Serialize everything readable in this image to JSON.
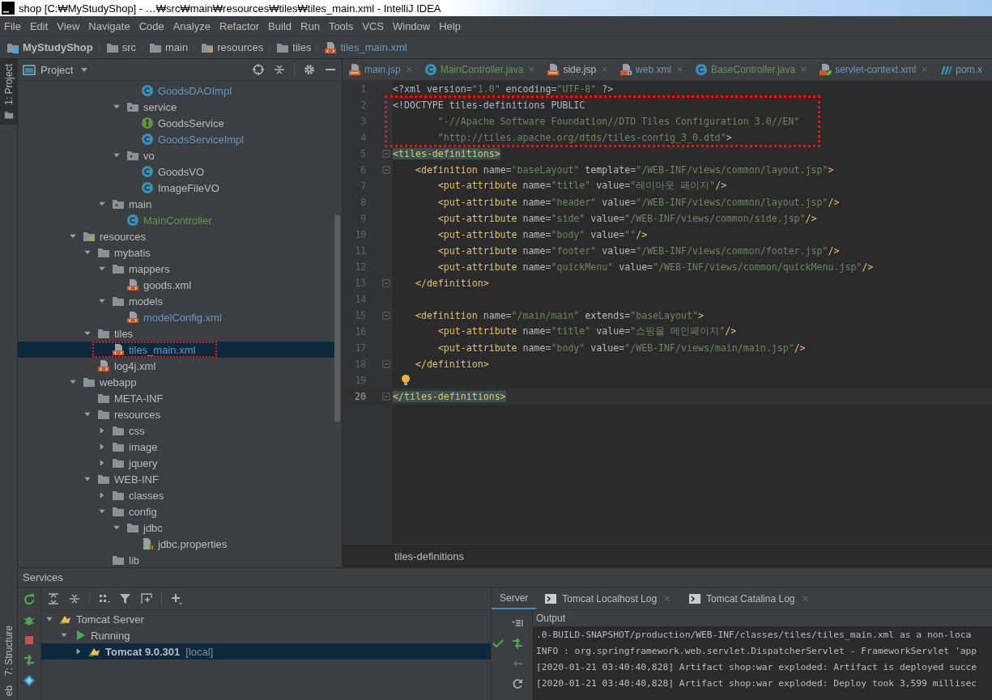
{
  "window": {
    "title": "shop [C:₩MyStudyShop] - …₩src₩main₩resources₩tiles₩tiles_main.xml - IntelliJ IDEA"
  },
  "menu": [
    "File",
    "Edit",
    "View",
    "Navigate",
    "Code",
    "Analyze",
    "Refactor",
    "Build",
    "Run",
    "Tools",
    "VCS",
    "Window",
    "Help"
  ],
  "breadcrumbs": [
    {
      "label": "MyStudyShop",
      "kind": "module"
    },
    {
      "label": "src",
      "kind": "folder"
    },
    {
      "label": "main",
      "kind": "folder"
    },
    {
      "label": "resources",
      "kind": "resfolder"
    },
    {
      "label": "tiles",
      "kind": "folder"
    },
    {
      "label": "tiles_main.xml",
      "kind": "xml"
    }
  ],
  "tool_stripe": {
    "top": [
      {
        "label": "1: Project",
        "selected": true
      }
    ],
    "bottom": [
      {
        "label": "7: Structure",
        "selected": false
      },
      {
        "label": "eb",
        "selected": false
      }
    ]
  },
  "project": {
    "title": "Project",
    "tree": [
      {
        "children": [
          {
            "children": [
              {
                "children": [
                  {
                    "children": [
                      {
                        "label": "GoodsDAOImpl",
                        "kind": "class",
                        "color": "#6897bb",
                        "selected": false
                      }
                    ]
                  },
                  {
                    "label": "service",
                    "kind": "package",
                    "expanded": true,
                    "color": "#bbbbbb",
                    "selected": false,
                    "children": [
                      {
                        "label": "GoodsService",
                        "kind": "interface",
                        "color": "#bbbbbb",
                        "selected": false
                      },
                      {
                        "label": "GoodsServiceImpl",
                        "kind": "class",
                        "color": "#6897bb",
                        "selected": false
                      }
                    ]
                  },
                  {
                    "label": "vo",
                    "kind": "package",
                    "expanded": true,
                    "color": "#bbbbbb",
                    "selected": false,
                    "children": [
                      {
                        "label": "GoodsVO",
                        "kind": "class",
                        "color": "#bbbbbb",
                        "selected": false
                      },
                      {
                        "label": "ImageFileVO",
                        "kind": "class",
                        "color": "#bbbbbb",
                        "selected": false
                      }
                    ]
                  }
                ]
              },
              {
                "label": "main",
                "kind": "package",
                "expanded": true,
                "color": "#bbbbbb",
                "selected": false,
                "children": [
                  {
                    "label": "MainController",
                    "kind": "class",
                    "color": "#629755",
                    "selected": false
                  }
                ]
              }
            ]
          }
        ]
      },
      {
        "label": "resources",
        "kind": "resfolder",
        "expanded": true,
        "color": "#bbbbbb",
        "selected": false,
        "children": [
          {
            "label": "mybatis",
            "kind": "folder",
            "expanded": true,
            "color": "#bbbbbb",
            "selected": false,
            "children": [
              {
                "label": "mappers",
                "kind": "folder",
                "expanded": true,
                "color": "#bbbbbb",
                "selected": false,
                "children": [
                  {
                    "label": "goods.xml",
                    "kind": "xml",
                    "color": "#bbbbbb",
                    "selected": false
                  }
                ]
              },
              {
                "label": "models",
                "kind": "folder",
                "expanded": true,
                "color": "#bbbbbb",
                "selected": false,
                "children": [
                  {
                    "label": "modelConfig.xml",
                    "kind": "xml",
                    "color": "#6897bb",
                    "selected": false
                  }
                ]
              }
            ]
          },
          {
            "label": "tiles",
            "kind": "folder",
            "expanded": true,
            "color": "#bbbbbb",
            "selected": false,
            "children": [
              {
                "label": "tiles_main.xml",
                "kind": "xml",
                "color": "#6897bb",
                "selected": true,
                "boxed": true
              }
            ]
          },
          {
            "label": "log4j.xml",
            "kind": "xml",
            "color": "#bbbbbb",
            "selected": false
          }
        ]
      },
      {
        "label": "webapp",
        "kind": "webfolder",
        "expanded": true,
        "color": "#bbbbbb",
        "selected": false,
        "children": [
          {
            "label": "META-INF",
            "kind": "folder",
            "color": "#bbbbbb",
            "selected": false
          },
          {
            "label": "resources",
            "kind": "folder",
            "expanded": true,
            "color": "#bbbbbb",
            "selected": false,
            "children": [
              {
                "label": "css",
                "kind": "folder",
                "expanded": false,
                "color": "#bbbbbb",
                "selected": false
              },
              {
                "label": "image",
                "kind": "folder",
                "expanded": false,
                "color": "#bbbbbb",
                "selected": false
              },
              {
                "label": "jquery",
                "kind": "folder",
                "expanded": false,
                "color": "#bbbbbb",
                "selected": false
              }
            ]
          },
          {
            "label": "WEB-INF",
            "kind": "folder",
            "expanded": true,
            "color": "#bbbbbb",
            "selected": false,
            "children": [
              {
                "label": "classes",
                "kind": "folder",
                "expanded": false,
                "color": "#bbbbbb",
                "selected": false
              },
              {
                "label": "config",
                "kind": "folder",
                "expanded": true,
                "color": "#bbbbbb",
                "selected": false,
                "children": [
                  {
                    "label": "jdbc",
                    "kind": "folder",
                    "expanded": true,
                    "color": "#bbbbbb",
                    "selected": false,
                    "children": [
                      {
                        "label": "jdbc.properties",
                        "kind": "props",
                        "color": "#bbbbbb",
                        "selected": false
                      }
                    ]
                  }
                ]
              },
              {
                "label": "lib",
                "kind": "folder",
                "color": "#bbbbbb",
                "selected": false
              }
            ]
          }
        ]
      }
    ]
  },
  "editor": {
    "tabs": [
      {
        "label": "main.jsp",
        "kind": "jsp",
        "color": "#6897bb",
        "selected": false,
        "closable": true
      },
      {
        "label": "MainController.java",
        "kind": "class",
        "color": "#629755",
        "selected": false,
        "closable": true
      },
      {
        "label": "side.jsp",
        "kind": "jsp",
        "color": "#bbbbbb",
        "selected": false,
        "closable": true
      },
      {
        "label": "web.xml",
        "kind": "webxml",
        "color": "#6897bb",
        "selected": false,
        "closable": true
      },
      {
        "label": "BaseController.java",
        "kind": "class",
        "color": "#629755",
        "selected": false,
        "closable": true
      },
      {
        "label": "servlet-context.xml",
        "kind": "spring",
        "color": "#6897bb",
        "selected": false,
        "closable": true
      },
      {
        "label": "pom.x",
        "kind": "maven",
        "color": "#6897bb",
        "selected": false,
        "closable": false
      }
    ],
    "lines": [
      {
        "n": "1",
        "tokens": [
          {
            "kind": "plain",
            "text": "<?xml "
          },
          {
            "kind": "attr",
            "text": "version="
          },
          {
            "kind": "str",
            "text": "\"1.0\""
          },
          {
            "kind": "attr",
            "text": " encoding="
          },
          {
            "kind": "str",
            "text": "\"UTF-8\""
          },
          {
            "kind": "plain",
            "text": " ?>"
          }
        ]
      },
      {
        "n": "2",
        "boxed": true,
        "tokens": [
          {
            "kind": "plain",
            "text": "<!DOCTYPE tiles-definitions PUBLIC"
          }
        ]
      },
      {
        "n": "3",
        "boxed": true,
        "tokens": [
          {
            "kind": "str",
            "text": "        \"-//Apache Software Foundation//DTD Tiles Configuration 3.0//EN\""
          }
        ]
      },
      {
        "n": "4",
        "boxed": true,
        "tokens": [
          {
            "kind": "str",
            "text": "        \"http://tiles.apache.org/dtds/tiles-config_3_0.dtd\""
          },
          {
            "kind": "plain",
            "text": ">"
          }
        ]
      },
      {
        "n": "5",
        "fold": true,
        "tokens": [
          {
            "kind": "match",
            "text": "<tiles-definitions>"
          }
        ]
      },
      {
        "n": "6",
        "fold": true,
        "tokens": [
          {
            "kind": "tag",
            "text": "    <definition "
          },
          {
            "kind": "attr",
            "text": "name="
          },
          {
            "kind": "str",
            "text": "\"baseLayout\""
          },
          {
            "kind": "attr",
            "text": " template="
          },
          {
            "kind": "str",
            "text": "\"/WEB-INF/views/common/layout.jsp\""
          },
          {
            "kind": "tag",
            "text": ">"
          }
        ]
      },
      {
        "n": "7",
        "tokens": [
          {
            "kind": "tag",
            "text": "        <put-attribute "
          },
          {
            "kind": "attr",
            "text": "name="
          },
          {
            "kind": "str",
            "text": "\"title\""
          },
          {
            "kind": "attr",
            "text": " value="
          },
          {
            "kind": "str",
            "text": "\"레이아웃 페이지\""
          },
          {
            "kind": "tag",
            "text": "/>"
          }
        ]
      },
      {
        "n": "8",
        "tokens": [
          {
            "kind": "tag",
            "text": "        <put-attribute "
          },
          {
            "kind": "attr",
            "text": "name="
          },
          {
            "kind": "str",
            "text": "\"header\""
          },
          {
            "kind": "attr",
            "text": " value="
          },
          {
            "kind": "str",
            "text": "\"/WEB-INF/views/common/layout.jsp\""
          },
          {
            "kind": "tag",
            "text": "/>"
          }
        ]
      },
      {
        "n": "9",
        "tokens": [
          {
            "kind": "tag",
            "text": "        <put-attribute "
          },
          {
            "kind": "attr",
            "text": "name="
          },
          {
            "kind": "str",
            "text": "\"side\""
          },
          {
            "kind": "attr",
            "text": " value="
          },
          {
            "kind": "str",
            "text": "\"/WEB-INF/views/common/side.jsp\""
          },
          {
            "kind": "tag",
            "text": "/>"
          }
        ]
      },
      {
        "n": "10",
        "tokens": [
          {
            "kind": "tag",
            "text": "        <put-attribute "
          },
          {
            "kind": "attr",
            "text": "name="
          },
          {
            "kind": "str",
            "text": "\"body\""
          },
          {
            "kind": "attr",
            "text": " value="
          },
          {
            "kind": "str",
            "text": "\"\""
          },
          {
            "kind": "tag",
            "text": "/>"
          }
        ]
      },
      {
        "n": "11",
        "tokens": [
          {
            "kind": "tag",
            "text": "        <put-attribute "
          },
          {
            "kind": "attr",
            "text": "name="
          },
          {
            "kind": "str",
            "text": "\"footer\""
          },
          {
            "kind": "attr",
            "text": " value="
          },
          {
            "kind": "str",
            "text": "\"/WEB-INF/views/common/footer.jsp\""
          },
          {
            "kind": "tag",
            "text": "/>"
          }
        ]
      },
      {
        "n": "12",
        "tokens": [
          {
            "kind": "tag",
            "text": "        <put-attribute "
          },
          {
            "kind": "attr",
            "text": "name="
          },
          {
            "kind": "str",
            "text": "\"quickMenu\""
          },
          {
            "kind": "attr",
            "text": " value="
          },
          {
            "kind": "str",
            "text": "\"/WEB-INF/views/common/quickMenu.jsp\""
          },
          {
            "kind": "tag",
            "text": "/>"
          }
        ]
      },
      {
        "n": "13",
        "fold": true,
        "tokens": [
          {
            "kind": "tag",
            "text": "    </definition>"
          }
        ]
      },
      {
        "n": "14"
      },
      {
        "n": "15",
        "fold": true,
        "tokens": [
          {
            "kind": "tag",
            "text": "    <definition "
          },
          {
            "kind": "attr",
            "text": "name="
          },
          {
            "kind": "str",
            "text": "\"/main/main\""
          },
          {
            "kind": "attr",
            "text": " extends="
          },
          {
            "kind": "str",
            "text": "\"baseLayout\""
          },
          {
            "kind": "tag",
            "text": ">"
          }
        ]
      },
      {
        "n": "16",
        "tokens": [
          {
            "kind": "tag",
            "text": "        <put-attribute "
          },
          {
            "kind": "attr",
            "text": "name="
          },
          {
            "kind": "str",
            "text": "\"title\""
          },
          {
            "kind": "attr",
            "text": " value="
          },
          {
            "kind": "str",
            "text": "\"쇼핑몰 메인페이지\""
          },
          {
            "kind": "tag",
            "text": "/>"
          }
        ]
      },
      {
        "n": "17",
        "tokens": [
          {
            "kind": "tag",
            "text": "        <put-attribute "
          },
          {
            "kind": "attr",
            "text": "name="
          },
          {
            "kind": "str",
            "text": "\"body\""
          },
          {
            "kind": "attr",
            "text": " value="
          },
          {
            "kind": "str",
            "text": "\"/WEB-INF/views/main/main.jsp\""
          },
          {
            "kind": "tag",
            "text": "/>"
          }
        ]
      },
      {
        "n": "18",
        "fold": true,
        "tokens": [
          {
            "kind": "tag",
            "text": "    </definition>"
          }
        ]
      },
      {
        "n": "19",
        "bulb": true
      },
      {
        "n": "20",
        "fold": true,
        "current": true,
        "tokens": [
          {
            "kind": "match",
            "text": "</tiles-definitions>"
          }
        ]
      }
    ],
    "footer": "tiles-definitions"
  },
  "services": {
    "title": "Services",
    "tree": [
      {
        "label": "Tomcat Server",
        "kind": "server",
        "expanded": true,
        "selected": false,
        "children": [
          {
            "label": "Running",
            "kind": "group",
            "expanded": true,
            "selected": false,
            "children": [
              {
                "label": "Tomcat 9.0.301",
                "kind": "instance",
                "note": "[local]",
                "expanded": false,
                "selected": true
              }
            ]
          }
        ]
      }
    ],
    "tabs": [
      {
        "label": "Server",
        "selected": true,
        "closable": false
      },
      {
        "label": "Tomcat Localhost Log",
        "selected": false,
        "closable": true
      },
      {
        "label": "Tomcat Catalina Log",
        "selected": false,
        "closable": true
      }
    ],
    "output_title": "Output",
    "log": [
      ".0-BUILD-SNAPSHOT/production/WEB-INF/classes/tiles/tiles_main.xml as a non-loca",
      "INFO : org.springframework.web.servlet.DispatcherServlet - FrameworkServlet 'app",
      "[2020-01-21 03:40:40,828] Artifact shop:war exploded: Artifact is deployed succe",
      "[2020-01-21 03:40:40,828] Artifact shop:war exploded: Deploy took 3,599 millisec"
    ]
  }
}
